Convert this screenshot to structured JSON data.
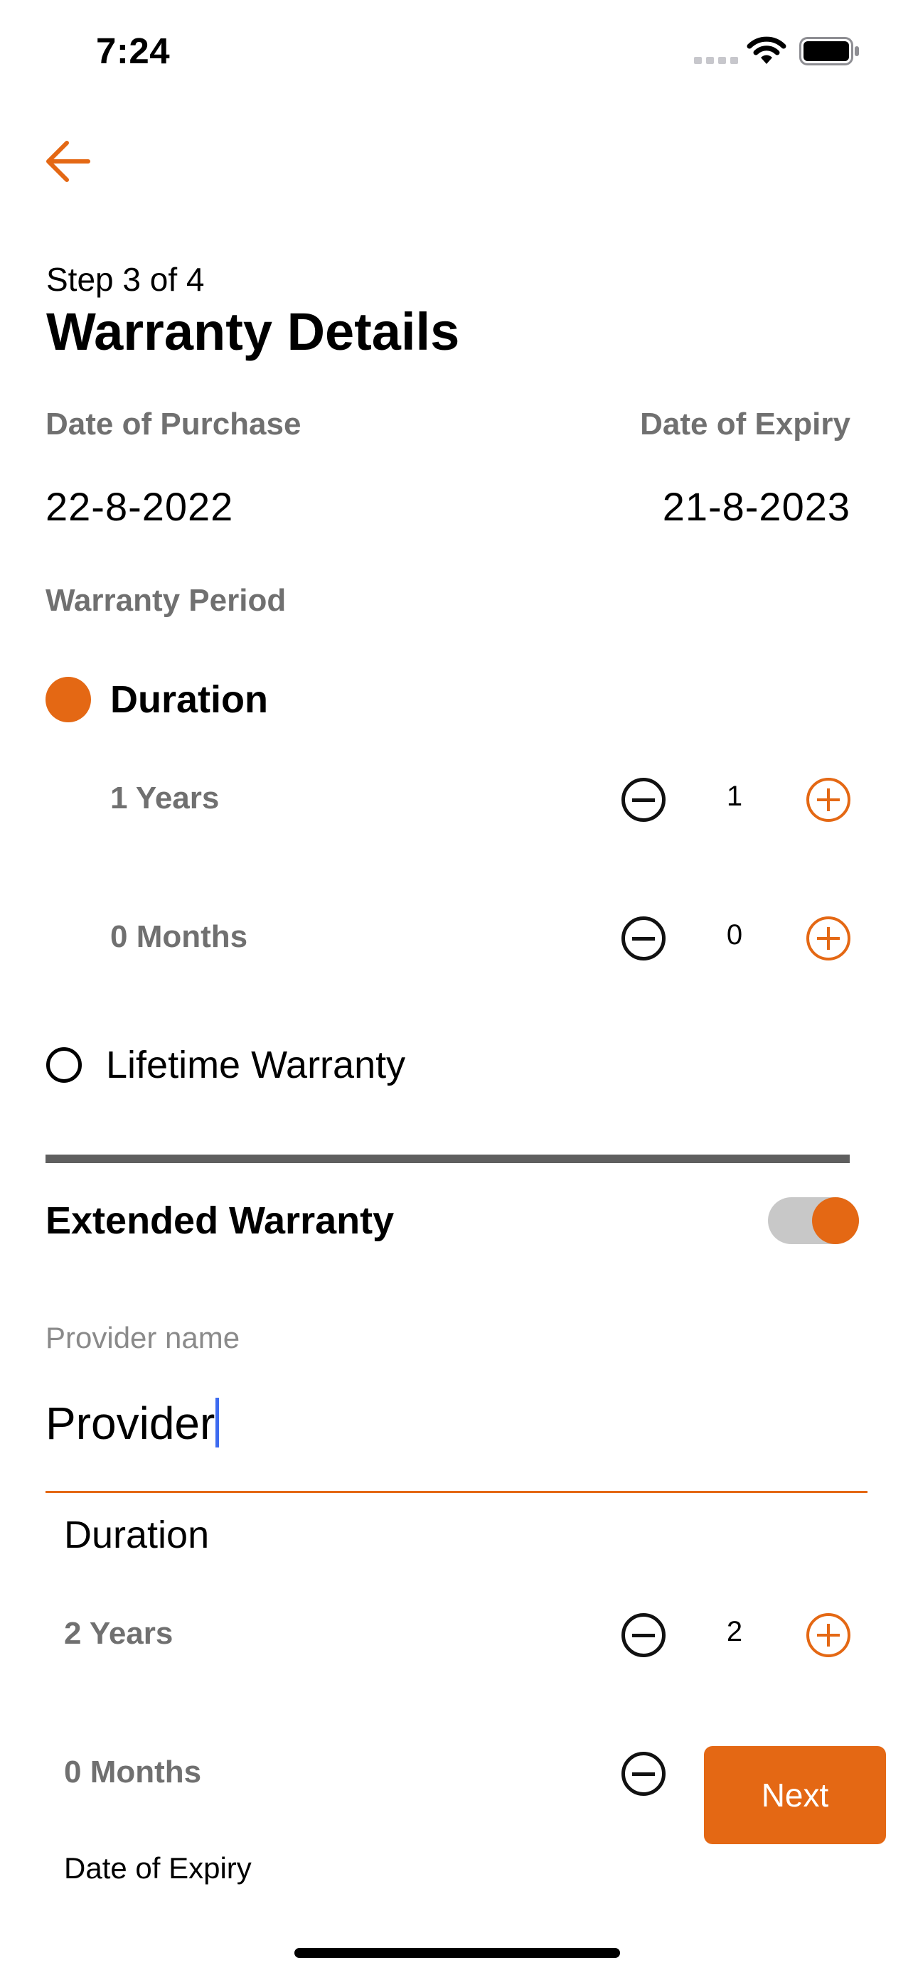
{
  "status_bar": {
    "time": "7:24"
  },
  "header": {
    "step": "Step 3 of 4",
    "title": "Warranty Details"
  },
  "dates": {
    "purchase_label": "Date of Purchase",
    "purchase_value": "22-8-2022",
    "expiry_label": "Date of Expiry",
    "expiry_value": "21-8-2023"
  },
  "warranty_period": {
    "label": "Warranty Period",
    "duration_label": "Duration",
    "duration_selected": true,
    "years_label": "1 Years",
    "years_value": "1",
    "months_label": "0 Months",
    "months_value": "0",
    "lifetime_label": "Lifetime Warranty"
  },
  "extended": {
    "label": "Extended Warranty",
    "enabled": true,
    "provider_label": "Provider name",
    "provider_value": "Provider",
    "duration_label": "Duration",
    "years_label": "2 Years",
    "years_value": "2",
    "months_label": "0 Months",
    "expiry_label": "Date of Expiry"
  },
  "actions": {
    "next_label": "Next"
  },
  "colors": {
    "accent": "#e46814",
    "muted": "#707070",
    "divider": "#5f5f5f",
    "cursor": "#3d6bf0"
  }
}
